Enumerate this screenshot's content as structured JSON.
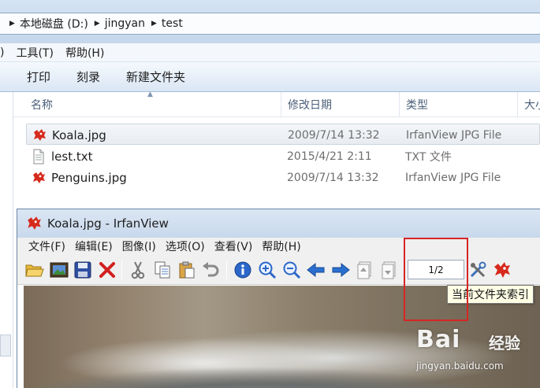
{
  "explorer": {
    "breadcrumb": [
      "本地磁盘 (D:)",
      "jingyan",
      "test"
    ],
    "menu": [
      ")",
      "工具(T)",
      "帮助(H)"
    ],
    "commands": [
      "打印",
      "刻录",
      "新建文件夹"
    ],
    "columns": {
      "name": "名称",
      "date": "修改日期",
      "type": "类型",
      "size": "大小"
    },
    "files": [
      {
        "name": "Koala.jpg",
        "date": "2009/7/14 13:32",
        "type": "IrfanView JPG File",
        "icon": "irfanview-icon",
        "selected": true
      },
      {
        "name": "lest.txt",
        "date": "2015/4/21 2:11",
        "type": "TXT 文件",
        "icon": "text-file-icon",
        "selected": false
      },
      {
        "name": "Penguins.jpg",
        "date": "2009/7/14 13:32",
        "type": "IrfanView JPG File",
        "icon": "irfanview-icon",
        "selected": false
      }
    ]
  },
  "irfanview": {
    "title": "Koala.jpg - IrfanView",
    "menu": [
      "文件(F)",
      "编辑(E)",
      "图像(I)",
      "选项(O)",
      "查看(V)",
      "帮助(H)"
    ],
    "page_indicator": "1/2",
    "tooltip": "当前文件夹索引",
    "toolbar_icons": [
      "open-folder-icon",
      "slideshow-icon",
      "save-icon",
      "delete-icon",
      "cut-icon",
      "copy-icon",
      "paste-icon",
      "undo-icon",
      "info-icon",
      "zoom-in-icon",
      "zoom-out-icon",
      "previous-icon",
      "next-icon",
      "previous-page-icon",
      "next-page-icon",
      "settings-icon",
      "irfanview-logo-icon"
    ]
  },
  "watermark": {
    "logo": "Bai",
    "text": "经验",
    "url": "jingyan.baidu.com"
  },
  "colors": {
    "annotation": "#d82424",
    "tooltip_bg": "#ffffe6",
    "arrow_blue": "#2a6fd0"
  }
}
